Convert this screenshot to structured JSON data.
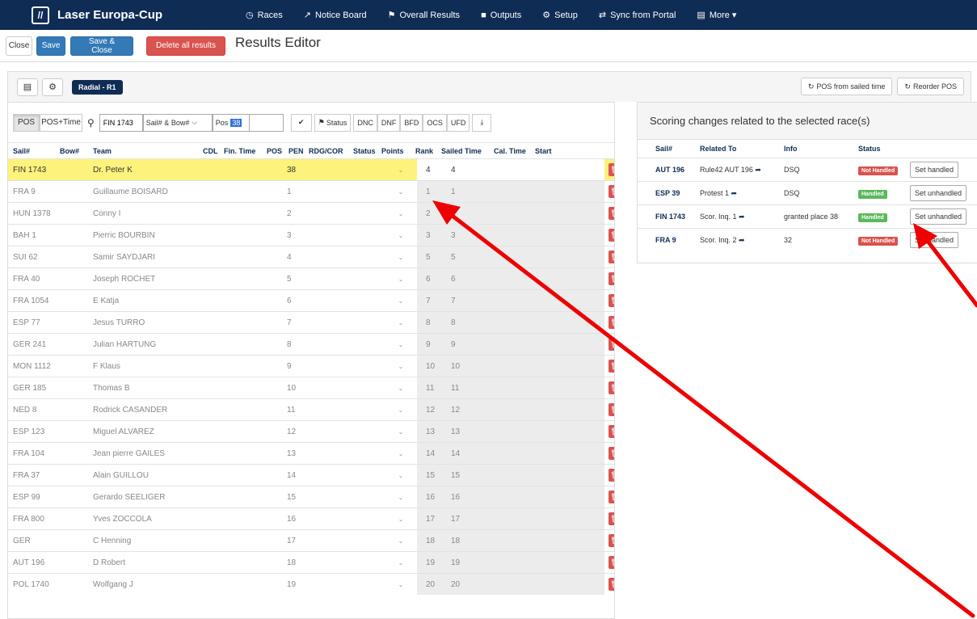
{
  "navbar": {
    "logo_text": "//",
    "app_title": "Laser Europa-Cup",
    "items": [
      {
        "label": "Races",
        "icon": "clock-icon",
        "glyph": "◷"
      },
      {
        "label": "Notice Board",
        "icon": "pin-icon",
        "glyph": "↗"
      },
      {
        "label": "Overall Results",
        "icon": "flag-icon",
        "glyph": "⚑"
      },
      {
        "label": "Outputs",
        "icon": "file-icon",
        "glyph": "■"
      },
      {
        "label": "Setup",
        "icon": "gear-icon",
        "glyph": "⚙"
      },
      {
        "label": "Sync from Portal",
        "icon": "sync-icon",
        "glyph": "⇄"
      },
      {
        "label": "More ▾",
        "icon": "more-icon",
        "glyph": "▤"
      }
    ]
  },
  "toolbar": {
    "close_label": "Close",
    "save_label": "Save",
    "save_close_label": "Save & Close",
    "delete_all_label": "Delete all results",
    "page_title": "Results Editor"
  },
  "subbar": {
    "race_badge": "Radial - R1",
    "pos_from_sailed": "POS from sailed time",
    "reorder_pos": "Reorder POS"
  },
  "entry": {
    "mode_pos": "POS",
    "mode_pos_time": "POS+Time",
    "sail_input": "FIN 1743",
    "sel_mode": "Sail# & Bow#",
    "pos_label": "Pos",
    "pos_value": "38",
    "status_btn": "Status",
    "codes": [
      "DNC",
      "DNF",
      "BFD",
      "OCS",
      "UFD"
    ]
  },
  "grid_headers": {
    "sail": "Sail#",
    "bow": "Bow#",
    "team": "Team",
    "cdl": "CDL",
    "fin_time": "Fin. Time",
    "pos": "POS",
    "pen": "PEN",
    "rdg": "RDG/COR",
    "status": "Status",
    "points": "Points",
    "rank": "Rank",
    "sailed": "Sailed Time",
    "cal": "Cal. Time",
    "start": "Start"
  },
  "rows": [
    {
      "sail": "FIN 1743",
      "team": "Dr. Peter K",
      "pos": "38",
      "points": "4",
      "rank": "4"
    },
    {
      "sail": "FRA 9",
      "team": "Guillaume BOISARD",
      "pos": "1",
      "points": "1",
      "rank": "1"
    },
    {
      "sail": "HUN 1378",
      "team": "Conny I",
      "pos": "2",
      "points": "2",
      "rank": "2"
    },
    {
      "sail": "BAH 1",
      "team": "Pierric BOURBIN",
      "pos": "3",
      "points": "3",
      "rank": "3"
    },
    {
      "sail": "SUI 62",
      "team": "Samir SAYDJARI",
      "pos": "4",
      "points": "5",
      "rank": "5"
    },
    {
      "sail": "FRA 40",
      "team": "Joseph ROCHET",
      "pos": "5",
      "points": "6",
      "rank": "6"
    },
    {
      "sail": "FRA 1054",
      "team": "E Katja",
      "pos": "6",
      "points": "7",
      "rank": "7"
    },
    {
      "sail": "ESP 77",
      "team": "Jesus TURRO",
      "pos": "7",
      "points": "8",
      "rank": "8"
    },
    {
      "sail": "GER 241",
      "team": "Julian HARTUNG",
      "pos": "8",
      "points": "9",
      "rank": "9"
    },
    {
      "sail": "MON 1112",
      "team": "F Klaus",
      "pos": "9",
      "points": "10",
      "rank": "10"
    },
    {
      "sail": "GER 185",
      "team": "Thomas B",
      "pos": "10",
      "points": "11",
      "rank": "11"
    },
    {
      "sail": "NED 8",
      "team": "Rodrick CASANDER",
      "pos": "11",
      "points": "12",
      "rank": "12"
    },
    {
      "sail": "ESP 123",
      "team": "Miguel ALVAREZ",
      "pos": "12",
      "points": "13",
      "rank": "13"
    },
    {
      "sail": "FRA 104",
      "team": "Jean pierre GAILES",
      "pos": "13",
      "points": "14",
      "rank": "14"
    },
    {
      "sail": "FRA 37",
      "team": "Alain GUILLOU",
      "pos": "14",
      "points": "15",
      "rank": "15"
    },
    {
      "sail": "ESP 99",
      "team": "Gerardo SEELIGER",
      "pos": "15",
      "points": "16",
      "rank": "16"
    },
    {
      "sail": "FRA 800",
      "team": "Yves ZOCCOLA",
      "pos": "16",
      "points": "17",
      "rank": "17"
    },
    {
      "sail": "GER",
      "team": "C Henning",
      "pos": "17",
      "points": "18",
      "rank": "18"
    },
    {
      "sail": "AUT 196",
      "team": "D Robert",
      "pos": "18",
      "points": "19",
      "rank": "19"
    },
    {
      "sail": "POL 1740",
      "team": "Wolfgang J",
      "pos": "19",
      "points": "20",
      "rank": "20"
    }
  ],
  "scoring": {
    "title": "Scoring changes related to the selected race(s)",
    "headers": {
      "sail": "Sail#",
      "related": "Related To",
      "info": "Info",
      "status": "Status"
    },
    "rows": [
      {
        "sail": "AUT 196",
        "related": "Rule42 AUT 196",
        "info": "DSQ",
        "status": "Not Handled",
        "status_color": "#d9534f",
        "action": "Set handled"
      },
      {
        "sail": "ESP 39",
        "related": "Protest 1",
        "info": "DSQ",
        "status": "Handled",
        "status_color": "#5cb85c",
        "action": "Set unhandled"
      },
      {
        "sail": "FIN 1743",
        "related": "Scor. Inq. 1",
        "info": "granted place 38",
        "status": "Handled",
        "status_color": "#5cb85c",
        "action": "Set unhandled"
      },
      {
        "sail": "FRA 9",
        "related": "Scor. Inq. 2",
        "info": "32",
        "status": "Not Handled",
        "status_color": "#d9534f",
        "action": "Set handled"
      }
    ]
  },
  "colors": {
    "navbar": "#0f2c54",
    "highlight_row": "#fdf27c",
    "annotation_arrow": "#ee0000"
  }
}
